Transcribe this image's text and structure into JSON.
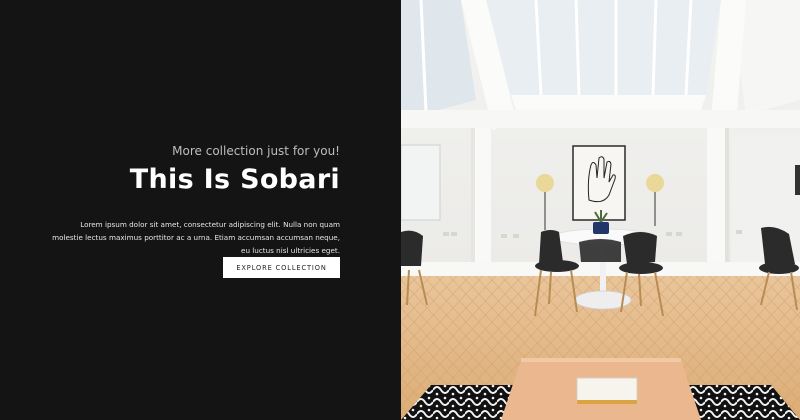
{
  "hero": {
    "tagline": "More collection just for you!",
    "title": "This Is Sobari",
    "description": "Lorem ipsum dolor sit amet, consectetur adipiscing elit. Nulla non quam molestie lectus maximus porttitor ac a urna. Etiam accumsan accumsan neque, eu luctus nisl ultricies eget.",
    "button_label": "EXPLORE COLLECTION"
  },
  "colors": {
    "panel_background": "#141414",
    "title_text": "#ffffff",
    "button_background": "#ffffff",
    "floor": "#e3b886"
  }
}
